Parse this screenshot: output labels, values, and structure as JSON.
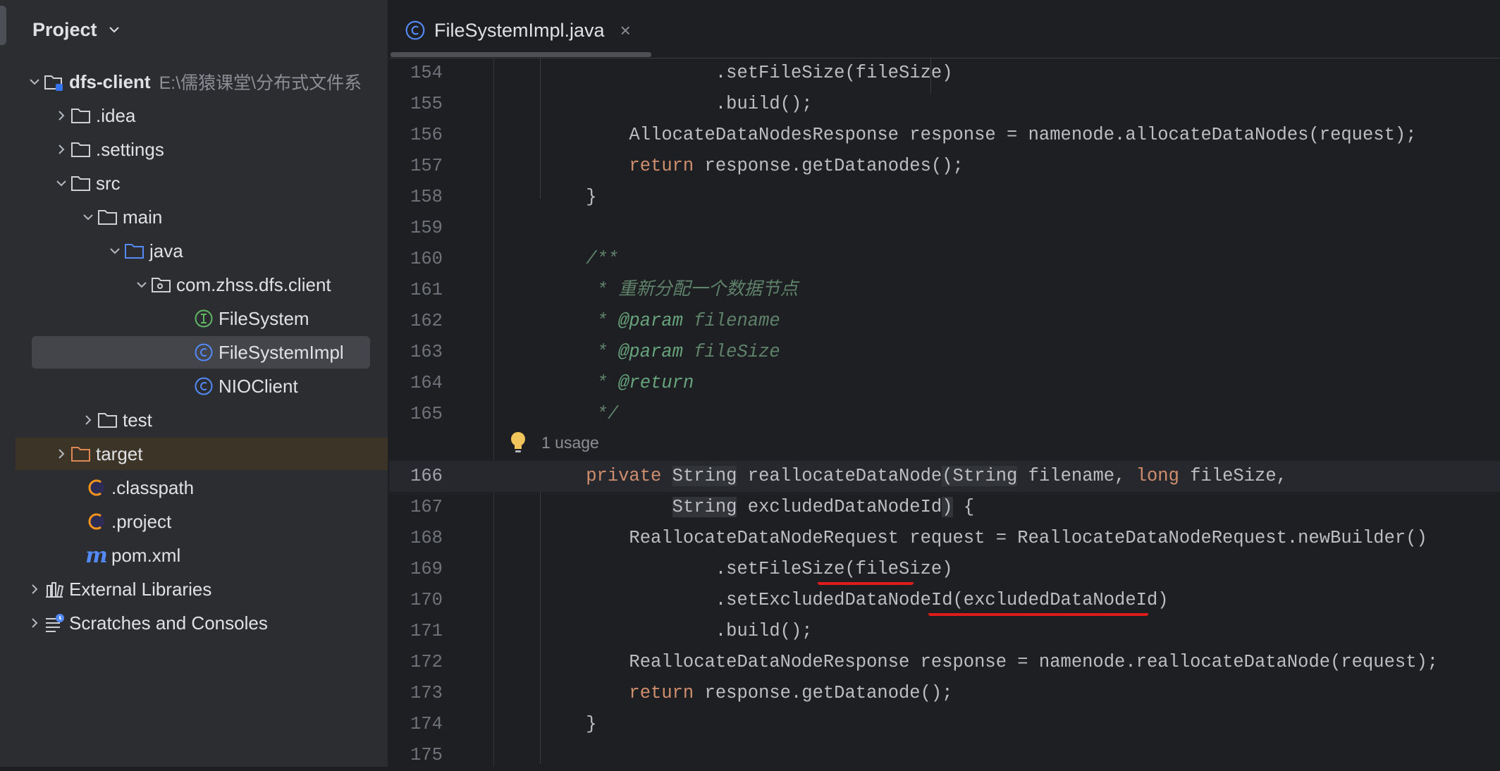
{
  "sidebar": {
    "title": "Project",
    "root": {
      "name": "dfs-client",
      "path_hint": "E:\\儒猿课堂\\分布式文件系"
    },
    "items": [
      {
        "label": ".idea"
      },
      {
        "label": ".settings"
      },
      {
        "label": "src"
      },
      {
        "label": "main"
      },
      {
        "label": "java"
      },
      {
        "label": "com.zhss.dfs.client"
      },
      {
        "label": "FileSystem"
      },
      {
        "label": "FileSystemImpl"
      },
      {
        "label": "NIOClient"
      },
      {
        "label": "test"
      },
      {
        "label": "target"
      },
      {
        "label": ".classpath"
      },
      {
        "label": ".project"
      },
      {
        "label": "pom.xml"
      },
      {
        "label": "External Libraries"
      },
      {
        "label": "Scratches and Consoles"
      }
    ]
  },
  "editor": {
    "tab": {
      "label": "FileSystemImpl.java",
      "close": "×"
    },
    "usage_hint": "1 usage",
    "line_numbers": [
      "154",
      "155",
      "156",
      "157",
      "158",
      "159",
      "160",
      "161",
      "162",
      "163",
      "164",
      "165",
      "166",
      "167",
      "168",
      "169",
      "170",
      "171",
      "172",
      "173",
      "174",
      "175"
    ]
  },
  "colors": {
    "background": "#1e1f22",
    "sidebar": "#2b2d30",
    "keyword": "#cf8e6d",
    "doc_comment": "#5f826b",
    "annotation_red": "#e01b1b"
  }
}
